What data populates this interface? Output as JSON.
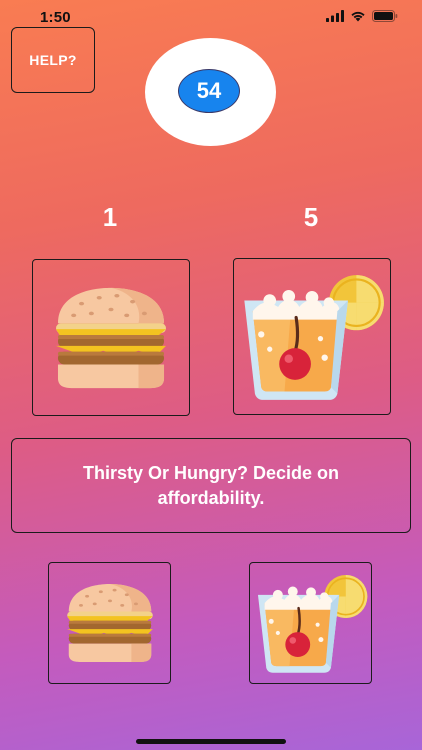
{
  "status_bar": {
    "time": "1:50",
    "icons": [
      "signal-icon",
      "wifi-icon",
      "battery-icon"
    ]
  },
  "header": {
    "help_label": "HELP?",
    "timer_value": "54"
  },
  "prices": {
    "left": "1",
    "right": "5"
  },
  "items": {
    "top_left": "burger-icon",
    "top_right": "drink-icon",
    "bottom_left": "burger-icon",
    "bottom_right": "drink-icon"
  },
  "message": "Thirsty Or Hungry? Decide on affordability.",
  "colors": {
    "timer_badge": "#1784ee",
    "background_top": "#f97c52",
    "background_bottom": "#a865d8"
  }
}
